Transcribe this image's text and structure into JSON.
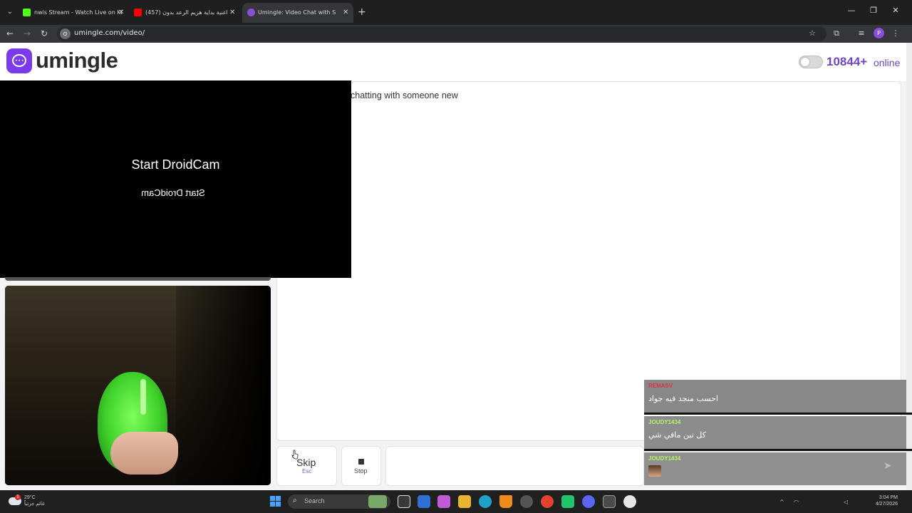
{
  "browser": {
    "tabs": [
      {
        "label": "nwis Stream - Watch Live on Ki",
        "color": "#53fc18"
      },
      {
        "label": "(457) اغنية بداية هزيم الرعد بدون",
        "color": "#ff0000"
      },
      {
        "label": "Umingle: Video Chat with S",
        "color": "#8a4fd8"
      }
    ],
    "new_tab": "+",
    "url": "umingle.com/video/",
    "profile_initial": "P",
    "controls": {
      "minimize": "—",
      "restore": "❐",
      "close": "✕"
    }
  },
  "site": {
    "brand": "umingle",
    "online_count": "10844+",
    "online_label": "online",
    "accent": "#7c3aed"
  },
  "remote_video": {
    "title": "Start DroidCam",
    "mirrored_title": "Start DroidCam"
  },
  "chat": {
    "status": "chatting with someone new",
    "input_placeholder": ""
  },
  "controls": {
    "skip_label": "Skip",
    "skip_hint": "Esc",
    "stop_label": "Stop"
  },
  "overlay_chat": [
    {
      "user": "REMASV",
      "color": "#d9334a",
      "message": "احسب منجد فيه جواد"
    },
    {
      "user": "JOUDY1434",
      "color": "#b7f26a",
      "message": "كل تبن مافي شي"
    },
    {
      "user": "JOUDY1434",
      "color": "#b7f26a",
      "message": ""
    }
  ],
  "taskbar": {
    "weather": "29°C\nغائم جزئياً",
    "weather_badge": "1",
    "search_placeholder": "Search",
    "time": "3:04 PM",
    "date": "4/27/2026"
  }
}
